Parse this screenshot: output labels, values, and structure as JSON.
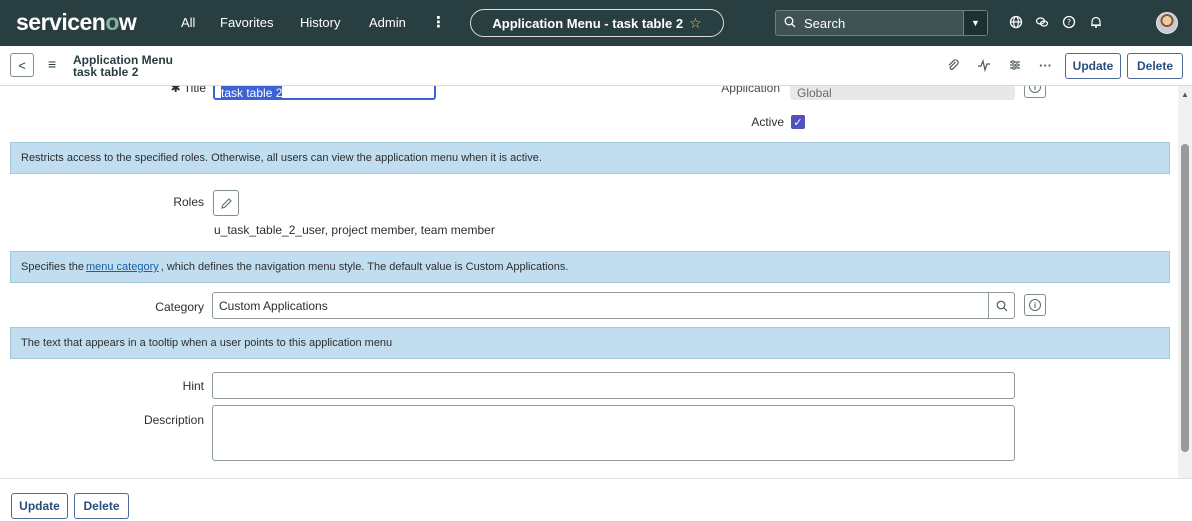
{
  "nav": {
    "logo_prefix": "servicen",
    "logo_o": "o",
    "logo_suffix": "w",
    "all": "All",
    "favorites": "Favorites",
    "history": "History",
    "admin": "Admin",
    "more": "⋮",
    "context_title": "Application Menu - task table 2",
    "search_placeholder": "Search"
  },
  "header": {
    "line1": "Application Menu",
    "line2": "task table 2",
    "update_label": "Update",
    "delete_label": "Delete"
  },
  "form": {
    "title_label": "Title",
    "title_value": "task table 2",
    "application_label": "Application",
    "application_value": "Global",
    "active_label": "Active",
    "active_checked": true,
    "roles_hint": "Restricts access to the specified roles. Otherwise, all users can view the application menu when it is active.",
    "roles_label": "Roles",
    "roles_value": "u_task_table_2_user, project member, team member",
    "category_hint_before": "Specifies the",
    "category_hint_link": "menu category",
    "category_hint_after": ", which defines the navigation menu style. The default value is Custom Applications.",
    "category_label": "Category",
    "category_value": "Custom Applications",
    "hint_hint": "The text that appears in a tooltip when a user points to this application menu",
    "hint_label": "Hint",
    "hint_value": "",
    "description_label": "Description",
    "description_value": ""
  },
  "footer": {
    "update_label": "Update",
    "delete_label": "Delete"
  },
  "colors": {
    "nav_bg": "#293e40",
    "annotation_bg": "#c0deef",
    "checkbox": "#4f52bd",
    "button_text": "#284f7c"
  }
}
